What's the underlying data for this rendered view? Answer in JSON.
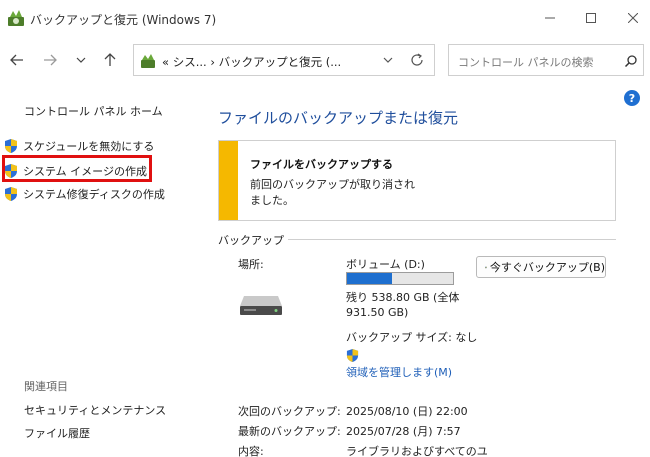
{
  "window": {
    "title": "バックアップと復元 (Windows 7)"
  },
  "address": {
    "crumbs": "«  シス...  ›  バックアップと復元 (..."
  },
  "search": {
    "placeholder": "コントロール パネルの検索"
  },
  "sidebar": {
    "home": "コントロール パネル ホーム",
    "tasks": [
      {
        "label": "スケジュールを無効にする"
      },
      {
        "label": "システム イメージの作成"
      },
      {
        "label": "システム修復ディスクの作成"
      }
    ],
    "related_title": "関連項目",
    "related": [
      {
        "label": "セキュリティとメンテナンス"
      },
      {
        "label": "ファイル履歴"
      }
    ]
  },
  "main": {
    "title": "ファイルのバックアップまたは復元",
    "warning": {
      "title": "ファイルをバックアップする",
      "message": "前回のバックアップが取り消されました。"
    },
    "backup_section": "バックアップ",
    "location_label": "場所:",
    "volume": "ボリューム (D:)",
    "used_fraction": 0.42,
    "space": "残り 538.80 GB (全体 931.50 GB)",
    "backup_size": "バックアップ サイズ: なし",
    "manage_link": "領域を管理します(M)",
    "backup_now_button": "今すぐバックアップ(B)",
    "info": [
      {
        "label": "次回のバックアップ:",
        "value": "2025/08/10 (日) 22:00"
      },
      {
        "label": "最新のバックアップ:",
        "value": "2025/07/28 (月) 7:57"
      },
      {
        "label": "内容:",
        "value": "ライブラリおよびすべてのユ"
      }
    ]
  },
  "colors": {
    "accent": "#1f4e9c",
    "link": "#1f5fb8",
    "warning_stripe": "#f5b800",
    "highlight": "#e01010",
    "progress": "#1e6fcf"
  }
}
